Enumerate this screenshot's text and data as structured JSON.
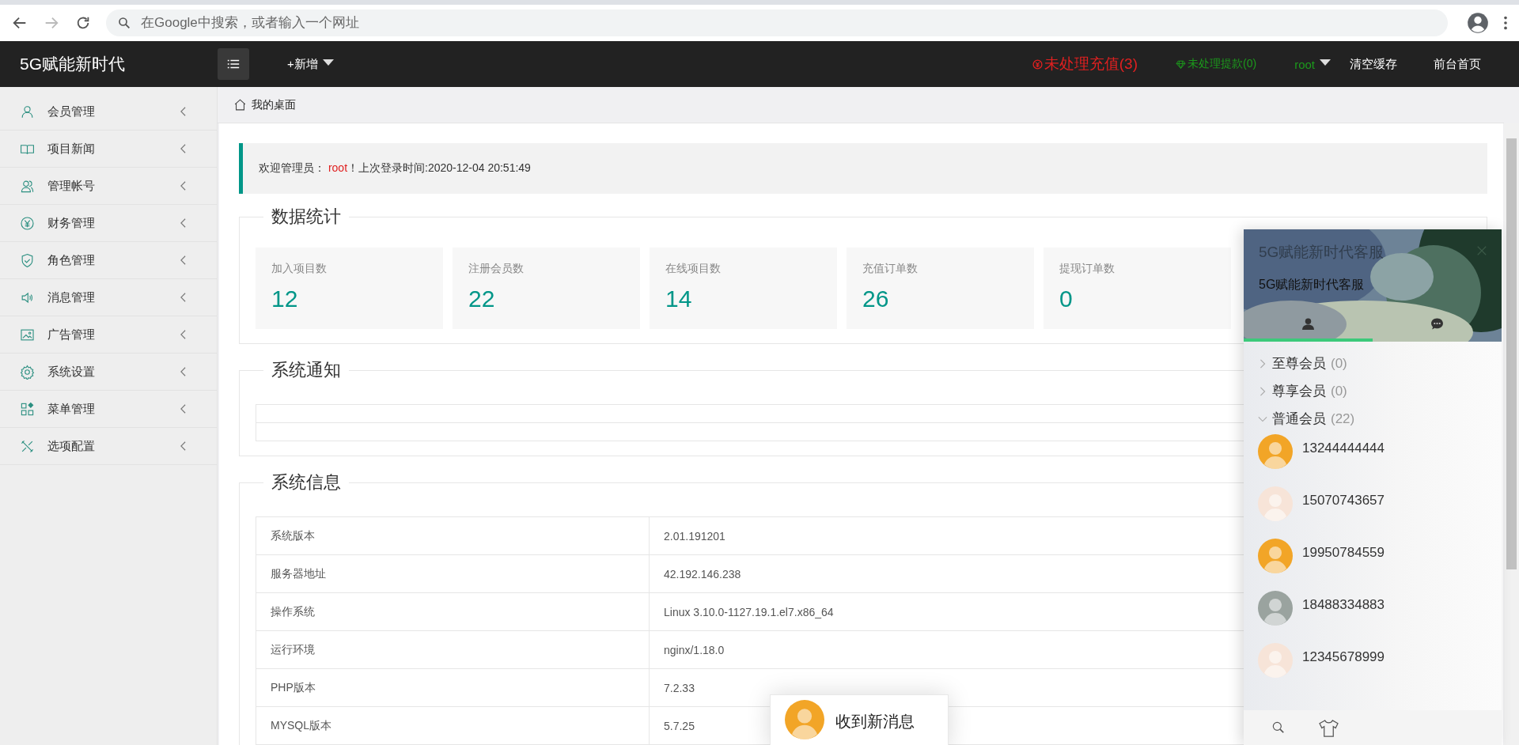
{
  "browser": {
    "address_placeholder": "在Google中搜索，或者输入一个网址"
  },
  "header": {
    "brand": "5G赋能新时代",
    "add_menu": "+新增",
    "alerts": [
      {
        "kind": "recharge",
        "label": "未处理充值(3)"
      },
      {
        "kind": "withdraw",
        "label": "未处理提款(0)"
      }
    ],
    "user": "root",
    "links": [
      "清空缓存",
      "前台首页"
    ]
  },
  "sidebar": {
    "items": [
      {
        "label": "会员管理",
        "expanded": false
      },
      {
        "label": "项目新闻",
        "expanded": false
      },
      {
        "label": "管理帐号",
        "expanded": false
      },
      {
        "label": "财务管理",
        "expanded": false
      },
      {
        "label": "角色管理",
        "expanded": false
      },
      {
        "label": "消息管理",
        "expanded": false
      },
      {
        "label": "广告管理",
        "expanded": false
      },
      {
        "label": "系统设置",
        "expanded": false
      },
      {
        "label": "菜单管理",
        "expanded": false
      },
      {
        "label": "选项配置",
        "expanded": false
      }
    ]
  },
  "breadcrumb": "我的桌面",
  "welcome": {
    "prefix": "欢迎管理员：",
    "user": "root",
    "suffix": "！上次登录时间:2020-12-04 20:51:49"
  },
  "stats": {
    "title": "数据统计",
    "cards": [
      {
        "label": "加入项目数",
        "value": "12"
      },
      {
        "label": "注册会员数",
        "value": "22"
      },
      {
        "label": "在线项目数",
        "value": "14"
      },
      {
        "label": "充值订单数",
        "value": "26"
      },
      {
        "label": "提现订单数",
        "value": "0"
      }
    ]
  },
  "notice": {
    "title": "系统通知"
  },
  "sysinfo": {
    "title": "系统信息",
    "rows": [
      {
        "label": "系统版本",
        "value": "2.01.191201"
      },
      {
        "label": "服务器地址",
        "value": "42.192.146.238"
      },
      {
        "label": "操作系统",
        "value": "Linux 3.10.0-1127.19.1.el7.x86_64"
      },
      {
        "label": "运行环境",
        "value": "nginx/1.18.0"
      },
      {
        "label": "PHP版本",
        "value": "7.2.33"
      },
      {
        "label": "MYSQL版本",
        "value": "5.7.25"
      }
    ]
  },
  "chat": {
    "title": "5G赋能新时代客服",
    "subtitle": "5G赋能新时代客服",
    "tabs": [
      {
        "kind": "contacts",
        "selected": true
      },
      {
        "kind": "chats",
        "selected": false
      }
    ],
    "groups": [
      {
        "name": "至尊会员",
        "count": "(0)",
        "expanded": false
      },
      {
        "name": "尊享会员",
        "count": "(0)",
        "expanded": false
      },
      {
        "name": "普通会员",
        "count": "(22)",
        "expanded": true,
        "contacts": [
          {
            "name": "13244444444",
            "color": "#f2a527"
          },
          {
            "name": "15070743657",
            "color": "#f7e4d8"
          },
          {
            "name": "19950784559",
            "color": "#f2a527"
          },
          {
            "name": "18488334883",
            "color": "#9aa39f"
          },
          {
            "name": "12345678999",
            "color": "#f7e4d8"
          }
        ]
      }
    ]
  },
  "toast": {
    "text": "收到新消息",
    "color": "#f2a527"
  }
}
